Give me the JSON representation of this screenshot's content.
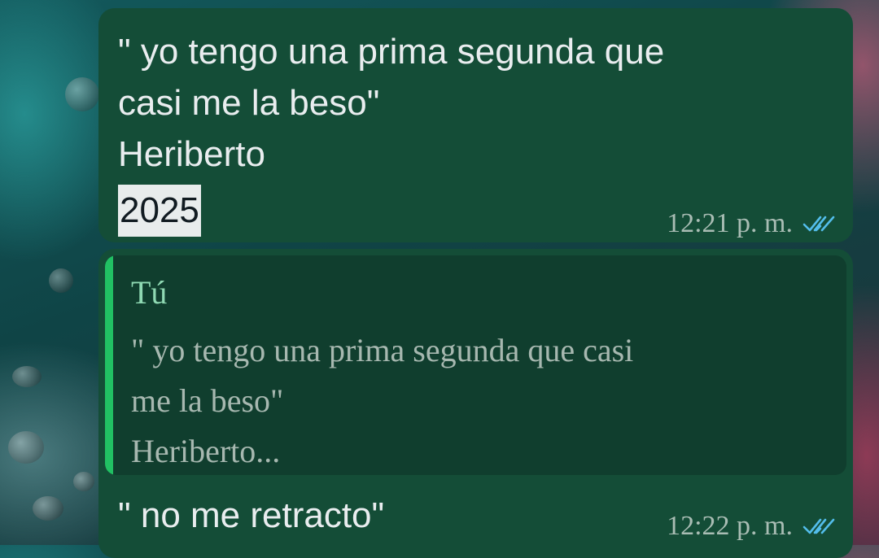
{
  "colors": {
    "bubble_outgoing": "#144d37",
    "quote_background": "#103e2e",
    "quote_accent": "#21c063",
    "tick_read": "#53bdeb"
  },
  "messages": [
    {
      "text": "\" yo tengo una prima segunda que\ncasi me la beso\"\nHeriberto",
      "highlighted_text": "2025",
      "time": "12:21 p. m.",
      "status_icon": "double-check-read-icon"
    },
    {
      "quoted": {
        "author": "Tú",
        "text": "\" yo tengo una prima segunda que casi\nme la beso\"\nHeriberto..."
      },
      "text": "\" no me retracto\"",
      "time": "12:22 p. m.",
      "status_icon": "double-check-read-icon"
    }
  ]
}
